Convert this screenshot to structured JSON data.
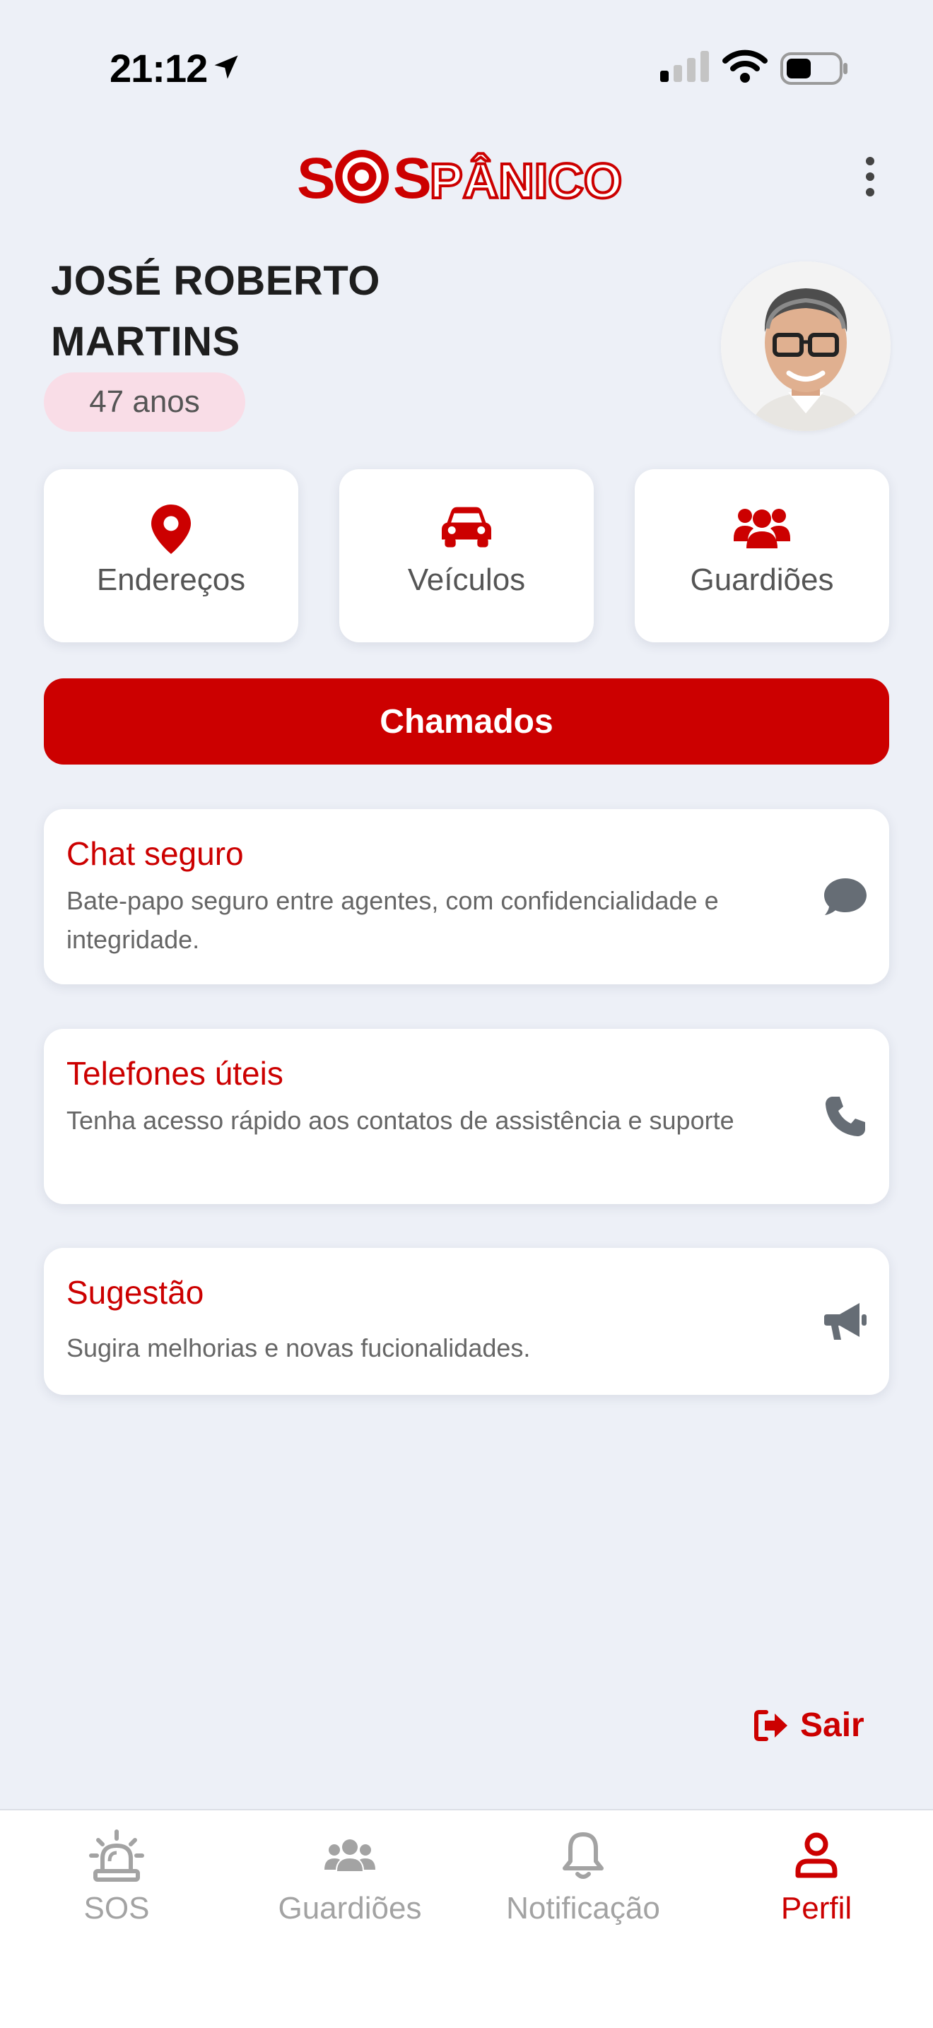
{
  "status_bar": {
    "time": "21:12"
  },
  "profile": {
    "name_line1": "JOSÉ ROBERTO",
    "name_line2": "MARTINS",
    "age": "47 anos"
  },
  "quick_actions": [
    {
      "label": "Endereços",
      "icon": "map-pin-icon"
    },
    {
      "label": "Veículos",
      "icon": "car-icon"
    },
    {
      "label": "Guardiões",
      "icon": "users-icon"
    }
  ],
  "primary_button": {
    "label": "Chamados"
  },
  "features": [
    {
      "title": "Chat seguro",
      "description": "Bate-papo seguro entre agentes, com confidencialidade e integridade.",
      "icon": "chat-bubble-icon"
    },
    {
      "title": "Telefones úteis",
      "description": "Tenha acesso rápido aos contatos de assistência e suporte",
      "icon": "phone-icon"
    },
    {
      "title": "Sugestão",
      "description": "Sugira melhorias e novas fucionalidades.",
      "icon": "megaphone-icon"
    }
  ],
  "logout": {
    "label": "Sair"
  },
  "tabs": [
    {
      "label": "SOS",
      "icon": "siren-icon",
      "active": false
    },
    {
      "label": "Guardiões",
      "icon": "users-icon",
      "active": false
    },
    {
      "label": "Notificação",
      "icon": "bell-icon",
      "active": false
    },
    {
      "label": "Perfil",
      "icon": "user-icon",
      "active": true
    }
  ],
  "colors": {
    "brand_red": "#cc0000",
    "background": "#edf0f7",
    "card": "#ffffff",
    "inactive_gray": "#a3a3a3",
    "age_pill": "#f9dde7"
  }
}
